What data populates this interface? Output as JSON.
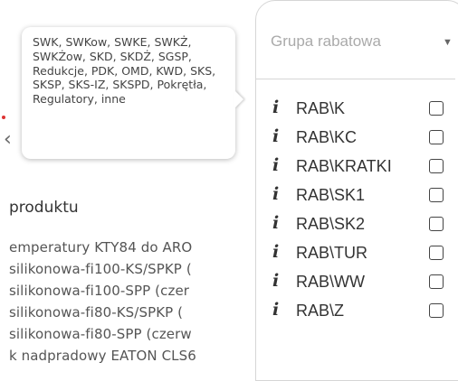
{
  "background": {
    "heading": "produktu",
    "rows": [
      "emperatury KTY84 do ARO",
      "silikonowa-fi100-KS/SPKP (",
      "silikonowa-fi100-SPP (czer",
      "silikonowa-fi80-KS/SPKP  (",
      "silikonowa-fi80-SPP (czerw",
      "k nadpradowy EATON CLS6"
    ]
  },
  "tooltip": {
    "text": "SWK, SWKow, SWKE, SWKŻ, SWKŻow, SKD, SKDŻ, SGSP, Redukcje, PDK, OMD, KWD, SKS, SKSP, SKS-IZ, SKSPD, Pokrętła, Regulatory, inne"
  },
  "filter": {
    "placeholder": "Grupa rabatowa",
    "info_glyph": "i",
    "items": [
      {
        "label": "RAB\\K",
        "checked": false
      },
      {
        "label": "RAB\\KC",
        "checked": false
      },
      {
        "label": "RAB\\KRATKI",
        "checked": false
      },
      {
        "label": "RAB\\SK1",
        "checked": false
      },
      {
        "label": "RAB\\SK2",
        "checked": false
      },
      {
        "label": "RAB\\TUR",
        "checked": false
      },
      {
        "label": "RAB\\WW",
        "checked": false
      },
      {
        "label": "RAB\\Z",
        "checked": false
      }
    ]
  },
  "icons": {
    "caret": "caret-down-icon",
    "back": "chevron-left-icon"
  }
}
